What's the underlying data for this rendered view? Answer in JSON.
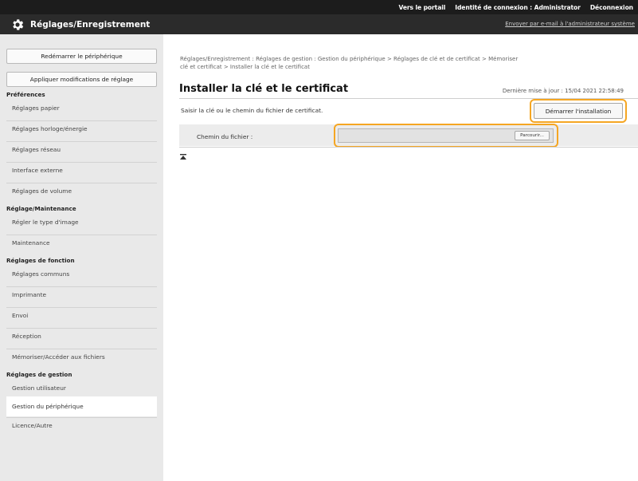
{
  "topbar": {
    "portal_link": "Vers le portail",
    "login_identity_label": "Identité de connexion :",
    "login_identity_value": "Administrator",
    "logout_link": "Déconnexion"
  },
  "header": {
    "title": "Réglages/Enregistrement",
    "mail_link": "Envoyer par e-mail à l'administrateur système",
    "icon": "gear-icon"
  },
  "sidebar": {
    "buttons": [
      "Redémarrer le périphérique",
      "Appliquer modifications de réglage"
    ],
    "sections": [
      {
        "title": "Préférences",
        "items": [
          "Réglages papier",
          "Réglages horloge/énergie",
          "Réglages réseau",
          "Interface externe",
          "Réglages de volume"
        ]
      },
      {
        "title": "Réglage/Maintenance",
        "items": [
          "Régler le type d'image",
          "Maintenance"
        ]
      },
      {
        "title": "Réglages de fonction",
        "items": [
          "Réglages communs",
          "Imprimante",
          "Envoi",
          "Réception",
          "Mémoriser/Accéder aux fichiers"
        ]
      },
      {
        "title": "Réglages de gestion",
        "items": [
          "Gestion utilisateur",
          "Gestion du périphérique",
          "Licence/Autre"
        ]
      }
    ],
    "active_item": "Gestion du périphérique"
  },
  "main": {
    "breadcrumb_line1": "Réglages/Enregistrement : Réglages de gestion : Gestion du périphérique > Réglages de clé et de certificat > Mémoriser",
    "breadcrumb_line2": "clé et certificat > Installer la clé et le certificat",
    "page_title": "Installer la clé et le certificat",
    "last_updated": "Dernière mise à jour : 15/04 2021 22:58:49",
    "instruction": "Saisir la clé ou le chemin du fichier de certificat.",
    "start_button": "Démarrer l'installation",
    "file_path_label": "Chemin du fichier :",
    "file_path_value": "",
    "browse_button": "Parcourir...",
    "top_icon": "back-to-top-icon"
  },
  "colors": {
    "highlight": "#f5a623",
    "topbar": "#1c1c1c",
    "titlebar": "#2b2b2b",
    "sidebar": "#e9e9e9"
  }
}
